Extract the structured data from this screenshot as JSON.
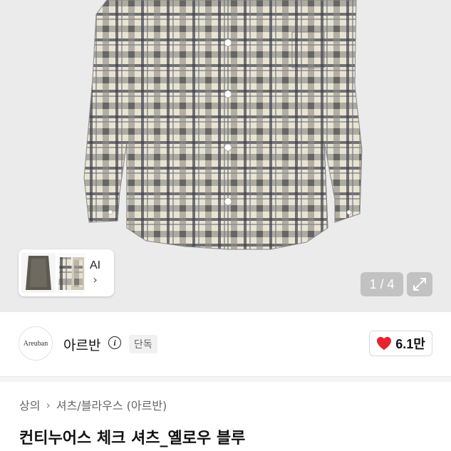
{
  "gallery": {
    "thumb_label": "AI",
    "counter": "1 / 4",
    "icons": {
      "expand": "expand-arrows-icon",
      "chevron": "chevron-right-icon"
    }
  },
  "brand": {
    "logo_text": "Areuban",
    "name": "아르반",
    "badge": "단독",
    "likes": "6.1만",
    "heart_color": "#e8232e"
  },
  "breadcrumb": {
    "items": [
      "상의",
      "셔츠/블라우스 (아르반)"
    ]
  },
  "product": {
    "title": "컨티누어스 체크 셔츠_옐로우 블루"
  }
}
